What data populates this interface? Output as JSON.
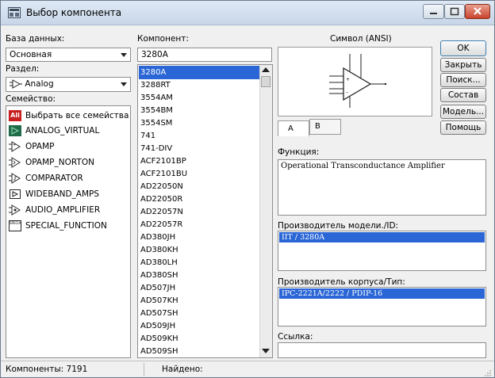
{
  "window": {
    "title": "Выбор компонента"
  },
  "database": {
    "label": "База данных:",
    "value": "Основная"
  },
  "section": {
    "label": "Раздел:",
    "value": "Analog"
  },
  "families": {
    "label": "Семейство:",
    "items": [
      "Выбрать все семейства",
      "ANALOG_VIRTUAL",
      "OPAMP",
      "OPAMP_NORTON",
      "COMPARATOR",
      "WIDEBAND_AMPS",
      "AUDIO_AMPLIFIER",
      "SPECIAL_FUNCTION"
    ],
    "all_icon_text": "All",
    "special_icon_text": "SPECIAL"
  },
  "component": {
    "label": "Компонент:",
    "search_value": "3280A",
    "selected": "3280A",
    "items": [
      "3280A",
      "3288RT",
      "3554AM",
      "3554BM",
      "3554SM",
      "741",
      "741-DIV",
      "ACF2101BP",
      "ACF2101BU",
      "AD22050N",
      "AD22050R",
      "AD22057N",
      "AD22057R",
      "AD380JH",
      "AD380KH",
      "AD380LH",
      "AD380SH",
      "AD507JH",
      "AD507KH",
      "AD507SH",
      "AD509JH",
      "AD509KH",
      "AD509SH"
    ]
  },
  "symbol": {
    "label": "Символ (ANSI)",
    "tabs": [
      "A",
      "B"
    ]
  },
  "function": {
    "label": "Функция:",
    "value": "Operational Transconductance Amplifier"
  },
  "model_manufacturer": {
    "label": "Производитель модели./ID:",
    "value": "IIT / 3280A"
  },
  "package_manufacturer": {
    "label": "Производитель корпуса/Тип:",
    "value": "IPC-2221A/2222 / PDIP-16"
  },
  "link": {
    "label": "Ссылка:"
  },
  "buttons": {
    "ok": "OK",
    "close": "Закрыть",
    "search": "Поиск...",
    "detail": "Состав",
    "model": "Модель...",
    "help": "Помощь"
  },
  "status": {
    "components_label": "Компоненты: 7191",
    "found_label": "Найдено:"
  },
  "colors": {
    "selection": "#2a66d6",
    "close_button": "#c9442d"
  }
}
